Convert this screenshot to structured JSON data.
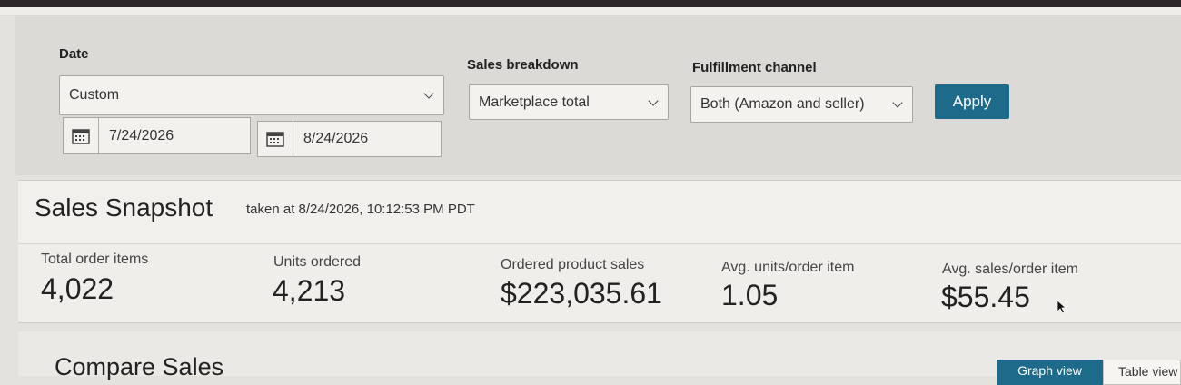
{
  "filters": {
    "date_label": "Date",
    "date_select": "Custom",
    "start_date": "7/24/2026",
    "end_date": "8/24/2026",
    "breakdown_label": "Sales breakdown",
    "breakdown_select": "Marketplace total",
    "channel_label": "Fulfillment channel",
    "channel_select": "Both (Amazon and seller)",
    "apply_label": "Apply"
  },
  "snapshot": {
    "title": "Sales Snapshot",
    "subtitle": "taken at 8/24/2026, 10:12:53 PM PDT",
    "metrics": [
      {
        "label": "Total order items",
        "value": "4,022"
      },
      {
        "label": "Units ordered",
        "value": "4,213"
      },
      {
        "label": "Ordered product sales",
        "value": "$223,035.61"
      },
      {
        "label": "Avg. units/order item",
        "value": "1.05"
      },
      {
        "label": "Avg. sales/order item",
        "value": "$55.45"
      }
    ]
  },
  "compare": {
    "title": "Compare Sales",
    "graph_view_label": "Graph view",
    "table_view_label": "Table view"
  },
  "colors": {
    "accent": "#1d6a8a",
    "page_bg": "#dcdad6",
    "panel_bg": "#f2f0ec"
  }
}
